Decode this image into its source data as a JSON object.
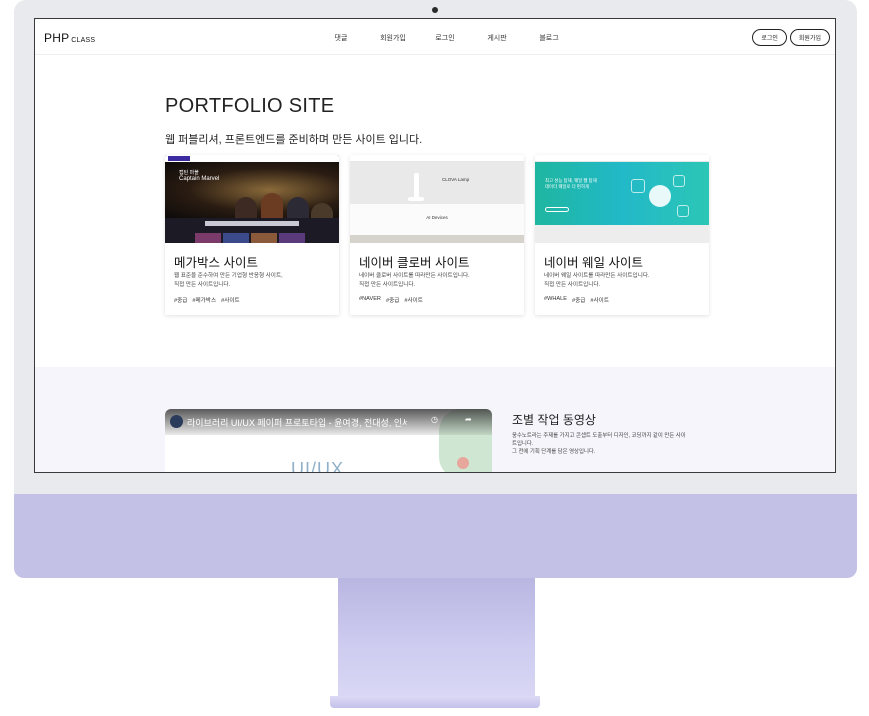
{
  "navbar": {
    "logo_main": "PHP",
    "logo_small": "CLASS",
    "menu": [
      "댓글",
      "회원가입",
      "로그인",
      "게시판",
      "블로그"
    ],
    "login_button": "로그인",
    "signup_button": "회원가입"
  },
  "hero": {
    "title": "PORTFOLIO SITE",
    "subtitle": "웹 퍼블리셔, 프론트엔드를 준비하며 만든 사이트 입니다."
  },
  "cards": [
    {
      "title": "메가박스 사이트",
      "desc_line1": "웹 표준을 준수하여 만든 기업형 반응형 사이트,",
      "desc_line2": "직접 만든 사이트입니다.",
      "tags": [
        "#중급",
        "#메가박스",
        "#사이트"
      ],
      "thumb_text1": "캡틴 마블",
      "thumb_text2": "Captain Marvel"
    },
    {
      "title": "네이버 클로버 사이트",
      "desc_line1": "네이버 클로버 사이트를 따라만든 사이트입니다.",
      "desc_line2": "직접 만든 사이트입니다.",
      "tags": [
        "#NAVER",
        "#중급",
        "#사이트"
      ],
      "thumb_text1": "CLOVA Lamp",
      "thumb_text2": "AI Devices"
    },
    {
      "title": "네이버 웨일 사이트",
      "desc_line1": "네이버 웨일 사이트를 따라만든 사이트입니다.",
      "desc_line2": "직접 만든 사이트입니다.",
      "tags": [
        "#WHALE",
        "#중급",
        "#사이트"
      ],
      "thumb_text1": "최고 성능 탑재, 웨일 웹 탑재",
      "thumb_text2": "데이터 웨일로 더 편하게"
    }
  ],
  "video_section": {
    "video_title": "라이브러리 UI/UX 페이퍼 프로토타입 - 윤여경, 전대성, 인세영, 조범수",
    "video_art_text": "UI/UX",
    "heading": "조별 작업 동영상",
    "desc_line1": "웅수노트라는 주제를 가지고 콘셉트 도출부터 디자인, 코딩까지 같이 만든 사이",
    "desc_line2": "트입니다.",
    "desc_line3": "그 전에 기획 단계를 담은 영상입니다."
  },
  "colors": {
    "chin": "#c3c1e6",
    "frame": "#e9eaee",
    "whale_teal": "#22b9c8",
    "lower_band": "#f6f5fb"
  }
}
